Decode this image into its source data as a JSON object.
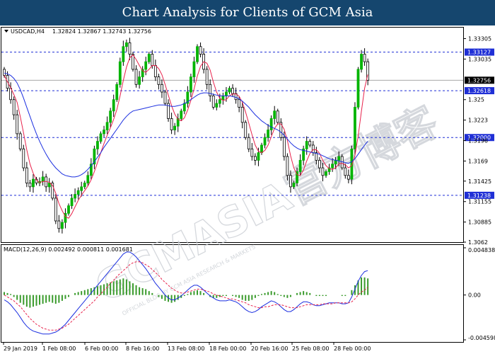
{
  "banner": {
    "title": "Chart Analysis for Clients of GCM Asia"
  },
  "watermark": {
    "main": "GCMASIA官方博客",
    "sub": "OFFICIAL BLOG BY GCM ASIA RESEARCH & MARKETS"
  },
  "chart_data": {
    "type": "candlestick",
    "symbol_label": "USDCAD,H4",
    "ohlc_text": "1.32824 1.32867 1.32743 1.32756",
    "price_axis": {
      "ticks": [
        1.33305,
        1.33035,
        1.325,
        1.3223,
        1.3196,
        1.3169,
        1.31425,
        1.31155,
        1.30885,
        1.3062
      ],
      "ylim": [
        1.3062,
        1.3345
      ]
    },
    "levels": [
      {
        "value": 1.33127,
        "label": "1.33127",
        "color": "#1f2fd6"
      },
      {
        "value": 1.32618,
        "label": "1.32618",
        "color": "#1f2fd6"
      },
      {
        "value": 1.32,
        "label": "1.32000",
        "color": "#1f2fd6"
      },
      {
        "value": 1.31238,
        "label": "1.31238",
        "color": "#1f2fd6"
      }
    ],
    "current_price": {
      "value": 1.32756,
      "label": "1.32756",
      "color": "#000000"
    },
    "x_axis_labels": [
      "29 Jan 2019",
      "1 Feb 08:00",
      "6 Feb 00:00",
      "8 Feb 16:00",
      "13 Feb 08:00",
      "18 Feb 00:00",
      "20 Feb 16:00",
      "25 Feb 08:00",
      "28 Feb 00:00"
    ],
    "closes": [
      1.3282,
      1.3265,
      1.325,
      1.323,
      1.3205,
      1.3185,
      1.316,
      1.314,
      1.3135,
      1.3145,
      1.314,
      1.3142,
      1.3148,
      1.3135,
      1.314,
      1.312,
      1.309,
      1.308,
      1.3088,
      1.31,
      1.311,
      1.312,
      1.3125,
      1.313,
      1.3135,
      1.314,
      1.315,
      1.3165,
      1.3185,
      1.3195,
      1.3205,
      1.321,
      1.322,
      1.3235,
      1.325,
      1.327,
      1.33,
      1.332,
      1.3325,
      1.331,
      1.329,
      1.327,
      1.328,
      1.329,
      1.33,
      1.331,
      1.3295,
      1.328,
      1.327,
      1.326,
      1.3245,
      1.3225,
      1.321,
      1.3215,
      1.3225,
      1.3235,
      1.3245,
      1.326,
      1.328,
      1.33,
      1.332,
      1.331,
      1.329,
      1.327,
      1.3255,
      1.324,
      1.3245,
      1.325,
      1.3255,
      1.326,
      1.3265,
      1.3258,
      1.325,
      1.324,
      1.322,
      1.32,
      1.3185,
      1.3175,
      1.317,
      1.318,
      1.319,
      1.32,
      1.321,
      1.3225,
      1.3235,
      1.322,
      1.32,
      1.3175,
      1.315,
      1.3135,
      1.314,
      1.3155,
      1.317,
      1.3185,
      1.3195,
      1.319,
      1.318,
      1.317,
      1.316,
      1.315,
      1.3155,
      1.316,
      1.3165,
      1.317,
      1.3175,
      1.316,
      1.315,
      1.3145,
      1.3185,
      1.324,
      1.329,
      1.331,
      1.33,
      1.32756
    ],
    "ma_slow": [
      1.3285,
      1.3284,
      1.3282,
      1.3278,
      1.3272,
      1.3263,
      1.3252,
      1.324,
      1.3228,
      1.3216,
      1.3205,
      1.3195,
      1.3186,
      1.3178,
      1.3171,
      1.3165,
      1.316,
      1.3156,
      1.3152,
      1.315,
      1.3149,
      1.3148,
      1.3148,
      1.3149,
      1.3151,
      1.3154,
      1.3158,
      1.3163,
      1.3168,
      1.3174,
      1.318,
      1.3187,
      1.3193,
      1.3199,
      1.3205,
      1.3211,
      1.3217,
      1.3223,
      1.3228,
      1.3232,
      1.3235,
      1.3236,
      1.3237,
      1.3238,
      1.3239,
      1.324,
      1.3241,
      1.3242,
      1.3243,
      1.3243,
      1.3243,
      1.3242,
      1.3241,
      1.3241,
      1.3242,
      1.3243,
      1.3245,
      1.3247,
      1.325,
      1.3253,
      1.3256,
      1.3258,
      1.3259,
      1.3259,
      1.3258,
      1.3257,
      1.3256,
      1.3255,
      1.3255,
      1.3255,
      1.3255,
      1.3254,
      1.3253,
      1.3251,
      1.3248,
      1.3244,
      1.324,
      1.3235,
      1.323,
      1.3226,
      1.3222,
      1.3219,
      1.3216,
      1.3214,
      1.3212,
      1.321,
      1.3207,
      1.3203,
      1.3198,
      1.3193,
      1.3189,
      1.3186,
      1.3184,
      1.3183,
      1.3182,
      1.3181,
      1.318,
      1.3179,
      1.3178,
      1.3176,
      1.3174,
      1.3172,
      1.3171,
      1.317,
      1.3169,
      1.3168,
      1.3167,
      1.3166,
      1.3168,
      1.3172,
      1.3178,
      1.3184,
      1.319,
      1.3195
    ],
    "macd_label": "MACD(12,26,9) 0.002492 0.000811 0.001681",
    "macd_axis": {
      "top": "0.004838",
      "zero": "0.00",
      "bottom": "-0.004598",
      "ylim": [
        -0.004598,
        0.004838
      ]
    },
    "macd_hist": [
      0.0003,
      0.0002,
      0.0001,
      -0.0002,
      -0.0005,
      -0.0008,
      -0.001,
      -0.0012,
      -0.0013,
      -0.0012,
      -0.0011,
      -0.001,
      -0.0009,
      -0.0008,
      -0.0007,
      -0.0008,
      -0.0009,
      -0.0008,
      -0.0006,
      -0.0004,
      -0.0002,
      0.0,
      0.0002,
      0.0003,
      0.0004,
      0.0005,
      0.0006,
      0.0007,
      0.0008,
      0.0009,
      0.001,
      0.0011,
      0.0012,
      0.0013,
      0.0014,
      0.0015,
      0.0016,
      0.0017,
      0.0016,
      0.0014,
      0.0012,
      0.001,
      0.0008,
      0.0007,
      0.0006,
      0.0004,
      0.0002,
      0.0,
      -0.0002,
      -0.0004,
      -0.0006,
      -0.0007,
      -0.0008,
      -0.0007,
      -0.0005,
      -0.0003,
      -0.0001,
      0.0001,
      0.0003,
      0.0004,
      0.0005,
      0.0004,
      0.0002,
      0.0,
      -0.0002,
      -0.0003,
      -0.0003,
      -0.0002,
      -0.0001,
      -0.0001,
      0.0,
      -0.0001,
      -0.0002,
      -0.0003,
      -0.0005,
      -0.0006,
      -0.0006,
      -0.0005,
      -0.0003,
      -0.0001,
      0.0001,
      0.0002,
      0.0003,
      0.0004,
      0.0003,
      0.0001,
      -0.0001,
      -0.0002,
      -0.0003,
      -0.0002,
      0.0,
      0.0002,
      0.0003,
      0.0004,
      0.0003,
      0.0002,
      0.0,
      -0.0001,
      -0.0001,
      -0.0001,
      -0.0001,
      0.0,
      0.0,
      0.0,
      0.0,
      -0.0001,
      -0.0001,
      0.0,
      0.0005,
      0.001,
      0.0015,
      0.0018,
      0.0018,
      0.0017
    ],
    "macd_line": [
      -0.0005,
      -0.0007,
      -0.001,
      -0.0014,
      -0.0018,
      -0.0023,
      -0.0028,
      -0.0032,
      -0.0035,
      -0.0037,
      -0.0038,
      -0.0039,
      -0.004,
      -0.004,
      -0.004,
      -0.0039,
      -0.0038,
      -0.0036,
      -0.0033,
      -0.003,
      -0.0026,
      -0.0022,
      -0.0018,
      -0.0014,
      -0.001,
      -0.0006,
      -0.0002,
      0.0002,
      0.0006,
      0.001,
      0.0014,
      0.0018,
      0.0022,
      0.0026,
      0.003,
      0.0034,
      0.0038,
      0.0042,
      0.0044,
      0.0044,
      0.0042,
      0.0039,
      0.0035,
      0.0031,
      0.0027,
      0.0022,
      0.0017,
      0.0012,
      0.0008,
      0.0004,
      0.0,
      -0.0003,
      -0.0005,
      -0.0005,
      -0.0003,
      -0.0001,
      0.0002,
      0.0005,
      0.0008,
      0.001,
      0.001,
      0.0008,
      0.0005,
      0.0002,
      -0.0001,
      -0.0003,
      -0.0005,
      -0.0006,
      -0.0006,
      -0.0006,
      -0.0005,
      -0.0006,
      -0.0007,
      -0.0009,
      -0.0012,
      -0.0015,
      -0.0017,
      -0.0018,
      -0.0017,
      -0.0015,
      -0.0012,
      -0.001,
      -0.0008,
      -0.0006,
      -0.0007,
      -0.0009,
      -0.0012,
      -0.0015,
      -0.0017,
      -0.0017,
      -0.0015,
      -0.0012,
      -0.0009,
      -0.0007,
      -0.0007,
      -0.0008,
      -0.001,
      -0.0011,
      -0.0011,
      -0.001,
      -0.0009,
      -0.0008,
      -0.0008,
      -0.0008,
      -0.0008,
      -0.0009,
      -0.0009,
      -0.0008,
      -0.0002,
      0.0006,
      0.0014,
      0.002,
      0.0024,
      0.0025
    ],
    "macd_signal": [
      0.0,
      -0.0002,
      -0.0004,
      -0.0006,
      -0.0009,
      -0.0012,
      -0.0016,
      -0.002,
      -0.0024,
      -0.0027,
      -0.003,
      -0.0032,
      -0.0034,
      -0.0035,
      -0.0036,
      -0.0036,
      -0.0036,
      -0.0035,
      -0.0034,
      -0.0032,
      -0.003,
      -0.0027,
      -0.0024,
      -0.0021,
      -0.0018,
      -0.0015,
      -0.0012,
      -0.0009,
      -0.0006,
      -0.0002,
      0.0001,
      0.0005,
      0.0008,
      0.0012,
      0.0015,
      0.0019,
      0.0022,
      0.0025,
      0.0028,
      0.0031,
      0.0033,
      0.0034,
      0.0034,
      0.0033,
      0.0031,
      0.0029,
      0.0026,
      0.0023,
      0.002,
      0.0016,
      0.0013,
      0.001,
      0.0007,
      0.0005,
      0.0003,
      0.0002,
      0.0002,
      0.0003,
      0.0004,
      0.0005,
      0.0006,
      0.0006,
      0.0005,
      0.0004,
      0.0003,
      0.0001,
      0.0,
      -0.0001,
      -0.0002,
      -0.0003,
      -0.0004,
      -0.0004,
      -0.0005,
      -0.0006,
      -0.0007,
      -0.0008,
      -0.001,
      -0.0011,
      -0.0012,
      -0.0013,
      -0.0013,
      -0.0012,
      -0.0012,
      -0.0011,
      -0.001,
      -0.001,
      -0.001,
      -0.0011,
      -0.0012,
      -0.0013,
      -0.0013,
      -0.0013,
      -0.0012,
      -0.0011,
      -0.001,
      -0.001,
      -0.001,
      -0.001,
      -0.001,
      -0.0009,
      -0.0009,
      -0.0009,
      -0.0009,
      -0.0008,
      -0.0008,
      -0.0008,
      -0.0008,
      -0.0008,
      -0.0007,
      -0.0004,
      0.0,
      0.0003,
      0.0005,
      0.0008
    ],
    "colors": {
      "bull": "#00b400",
      "bear": "#000000",
      "wick": "#000000",
      "ma_fast": "#e8224b",
      "ma_slow": "#1b2fe0",
      "macd_hist": "#3a9b2c",
      "macd_line": "#1b2fe0",
      "macd_signal": "#e8224b",
      "level_label_bg": "#1f2fd6",
      "banner_bg": "#15466e"
    }
  }
}
